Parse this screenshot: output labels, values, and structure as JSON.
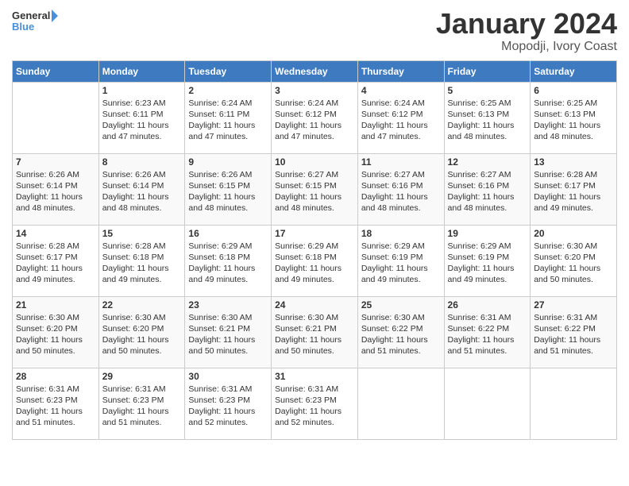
{
  "header": {
    "logo_general": "General",
    "logo_blue": "Blue",
    "month": "January 2024",
    "location": "Mopodji, Ivory Coast"
  },
  "days_of_week": [
    "Sunday",
    "Monday",
    "Tuesday",
    "Wednesday",
    "Thursday",
    "Friday",
    "Saturday"
  ],
  "weeks": [
    [
      {
        "day": "",
        "sunrise": "",
        "sunset": "",
        "daylight": ""
      },
      {
        "day": "1",
        "sunrise": "6:23 AM",
        "sunset": "6:11 PM",
        "daylight": "11 hours and 47 minutes."
      },
      {
        "day": "2",
        "sunrise": "6:24 AM",
        "sunset": "6:11 PM",
        "daylight": "11 hours and 47 minutes."
      },
      {
        "day": "3",
        "sunrise": "6:24 AM",
        "sunset": "6:12 PM",
        "daylight": "11 hours and 47 minutes."
      },
      {
        "day": "4",
        "sunrise": "6:24 AM",
        "sunset": "6:12 PM",
        "daylight": "11 hours and 47 minutes."
      },
      {
        "day": "5",
        "sunrise": "6:25 AM",
        "sunset": "6:13 PM",
        "daylight": "11 hours and 48 minutes."
      },
      {
        "day": "6",
        "sunrise": "6:25 AM",
        "sunset": "6:13 PM",
        "daylight": "11 hours and 48 minutes."
      }
    ],
    [
      {
        "day": "7",
        "sunrise": "6:26 AM",
        "sunset": "6:14 PM",
        "daylight": "11 hours and 48 minutes."
      },
      {
        "day": "8",
        "sunrise": "6:26 AM",
        "sunset": "6:14 PM",
        "daylight": "11 hours and 48 minutes."
      },
      {
        "day": "9",
        "sunrise": "6:26 AM",
        "sunset": "6:15 PM",
        "daylight": "11 hours and 48 minutes."
      },
      {
        "day": "10",
        "sunrise": "6:27 AM",
        "sunset": "6:15 PM",
        "daylight": "11 hours and 48 minutes."
      },
      {
        "day": "11",
        "sunrise": "6:27 AM",
        "sunset": "6:16 PM",
        "daylight": "11 hours and 48 minutes."
      },
      {
        "day": "12",
        "sunrise": "6:27 AM",
        "sunset": "6:16 PM",
        "daylight": "11 hours and 48 minutes."
      },
      {
        "day": "13",
        "sunrise": "6:28 AM",
        "sunset": "6:17 PM",
        "daylight": "11 hours and 49 minutes."
      }
    ],
    [
      {
        "day": "14",
        "sunrise": "6:28 AM",
        "sunset": "6:17 PM",
        "daylight": "11 hours and 49 minutes."
      },
      {
        "day": "15",
        "sunrise": "6:28 AM",
        "sunset": "6:18 PM",
        "daylight": "11 hours and 49 minutes."
      },
      {
        "day": "16",
        "sunrise": "6:29 AM",
        "sunset": "6:18 PM",
        "daylight": "11 hours and 49 minutes."
      },
      {
        "day": "17",
        "sunrise": "6:29 AM",
        "sunset": "6:18 PM",
        "daylight": "11 hours and 49 minutes."
      },
      {
        "day": "18",
        "sunrise": "6:29 AM",
        "sunset": "6:19 PM",
        "daylight": "11 hours and 49 minutes."
      },
      {
        "day": "19",
        "sunrise": "6:29 AM",
        "sunset": "6:19 PM",
        "daylight": "11 hours and 49 minutes."
      },
      {
        "day": "20",
        "sunrise": "6:30 AM",
        "sunset": "6:20 PM",
        "daylight": "11 hours and 50 minutes."
      }
    ],
    [
      {
        "day": "21",
        "sunrise": "6:30 AM",
        "sunset": "6:20 PM",
        "daylight": "11 hours and 50 minutes."
      },
      {
        "day": "22",
        "sunrise": "6:30 AM",
        "sunset": "6:20 PM",
        "daylight": "11 hours and 50 minutes."
      },
      {
        "day": "23",
        "sunrise": "6:30 AM",
        "sunset": "6:21 PM",
        "daylight": "11 hours and 50 minutes."
      },
      {
        "day": "24",
        "sunrise": "6:30 AM",
        "sunset": "6:21 PM",
        "daylight": "11 hours and 50 minutes."
      },
      {
        "day": "25",
        "sunrise": "6:30 AM",
        "sunset": "6:22 PM",
        "daylight": "11 hours and 51 minutes."
      },
      {
        "day": "26",
        "sunrise": "6:31 AM",
        "sunset": "6:22 PM",
        "daylight": "11 hours and 51 minutes."
      },
      {
        "day": "27",
        "sunrise": "6:31 AM",
        "sunset": "6:22 PM",
        "daylight": "11 hours and 51 minutes."
      }
    ],
    [
      {
        "day": "28",
        "sunrise": "6:31 AM",
        "sunset": "6:23 PM",
        "daylight": "11 hours and 51 minutes."
      },
      {
        "day": "29",
        "sunrise": "6:31 AM",
        "sunset": "6:23 PM",
        "daylight": "11 hours and 51 minutes."
      },
      {
        "day": "30",
        "sunrise": "6:31 AM",
        "sunset": "6:23 PM",
        "daylight": "11 hours and 52 minutes."
      },
      {
        "day": "31",
        "sunrise": "6:31 AM",
        "sunset": "6:23 PM",
        "daylight": "11 hours and 52 minutes."
      },
      {
        "day": "",
        "sunrise": "",
        "sunset": "",
        "daylight": ""
      },
      {
        "day": "",
        "sunrise": "",
        "sunset": "",
        "daylight": ""
      },
      {
        "day": "",
        "sunrise": "",
        "sunset": "",
        "daylight": ""
      }
    ]
  ],
  "labels": {
    "sunrise_prefix": "Sunrise: ",
    "sunset_prefix": "Sunset: ",
    "daylight_prefix": "Daylight: "
  }
}
